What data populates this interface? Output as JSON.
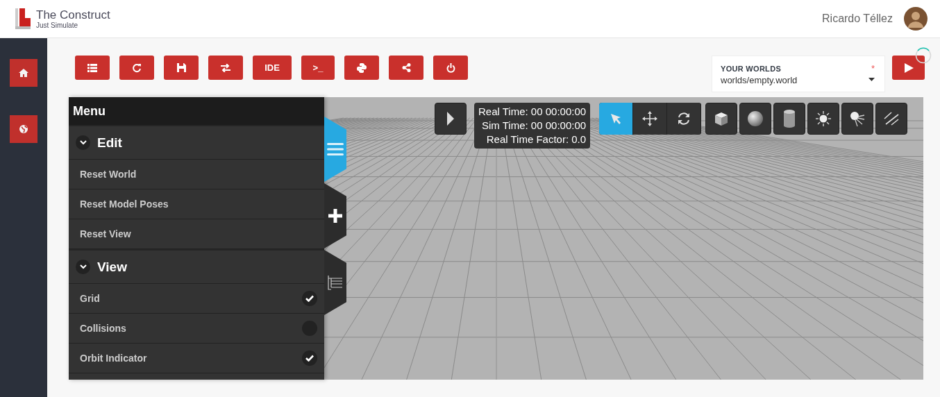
{
  "header": {
    "brand": "The Construct",
    "tagline": "Just Simulate",
    "user": "Ricardo Téllez"
  },
  "sidebar": {
    "items": [
      {
        "kind": "home"
      },
      {
        "kind": "globe"
      }
    ]
  },
  "toolbar": [
    {
      "kind": "list"
    },
    {
      "kind": "refresh"
    },
    {
      "kind": "save"
    },
    {
      "kind": "swap"
    },
    {
      "kind": "text",
      "label": "IDE"
    },
    {
      "kind": "text",
      "label": ">_"
    },
    {
      "kind": "python"
    },
    {
      "kind": "share"
    },
    {
      "kind": "power"
    }
  ],
  "worlds": {
    "label": "YOUR WORLDS",
    "required": "*",
    "value": "worlds/empty.world"
  },
  "viewport": {
    "time": [
      "Real Time: 00 00:00:00",
      "Sim Time: 00 00:00:00",
      "Real Time Factor: 0.0"
    ],
    "modes": [
      {
        "kind": "select",
        "selected": true
      },
      {
        "kind": "translate",
        "selected": false
      },
      {
        "kind": "rotate",
        "selected": false
      }
    ],
    "shapes": [
      {
        "kind": "box"
      },
      {
        "kind": "sphere"
      },
      {
        "kind": "cylinder"
      },
      {
        "kind": "pointlight"
      },
      {
        "kind": "spotlight"
      },
      {
        "kind": "dirlight"
      }
    ],
    "side_tabs": [
      {
        "kind": "menu",
        "selected": true
      },
      {
        "kind": "insert",
        "selected": false
      },
      {
        "kind": "tree",
        "selected": false
      }
    ],
    "menu": {
      "title": "Menu",
      "sections": [
        {
          "title": "Edit",
          "expanded": true,
          "items": [
            {
              "label": "Reset World",
              "kind": "action"
            },
            {
              "label": "Reset Model Poses",
              "kind": "action"
            },
            {
              "label": "Reset View",
              "kind": "action"
            }
          ]
        },
        {
          "title": "View",
          "expanded": true,
          "items": [
            {
              "label": "Grid",
              "kind": "toggle",
              "checked": true
            },
            {
              "label": "Collisions",
              "kind": "toggle",
              "checked": false
            },
            {
              "label": "Orbit Indicator",
              "kind": "toggle",
              "checked": true
            }
          ]
        }
      ]
    }
  }
}
